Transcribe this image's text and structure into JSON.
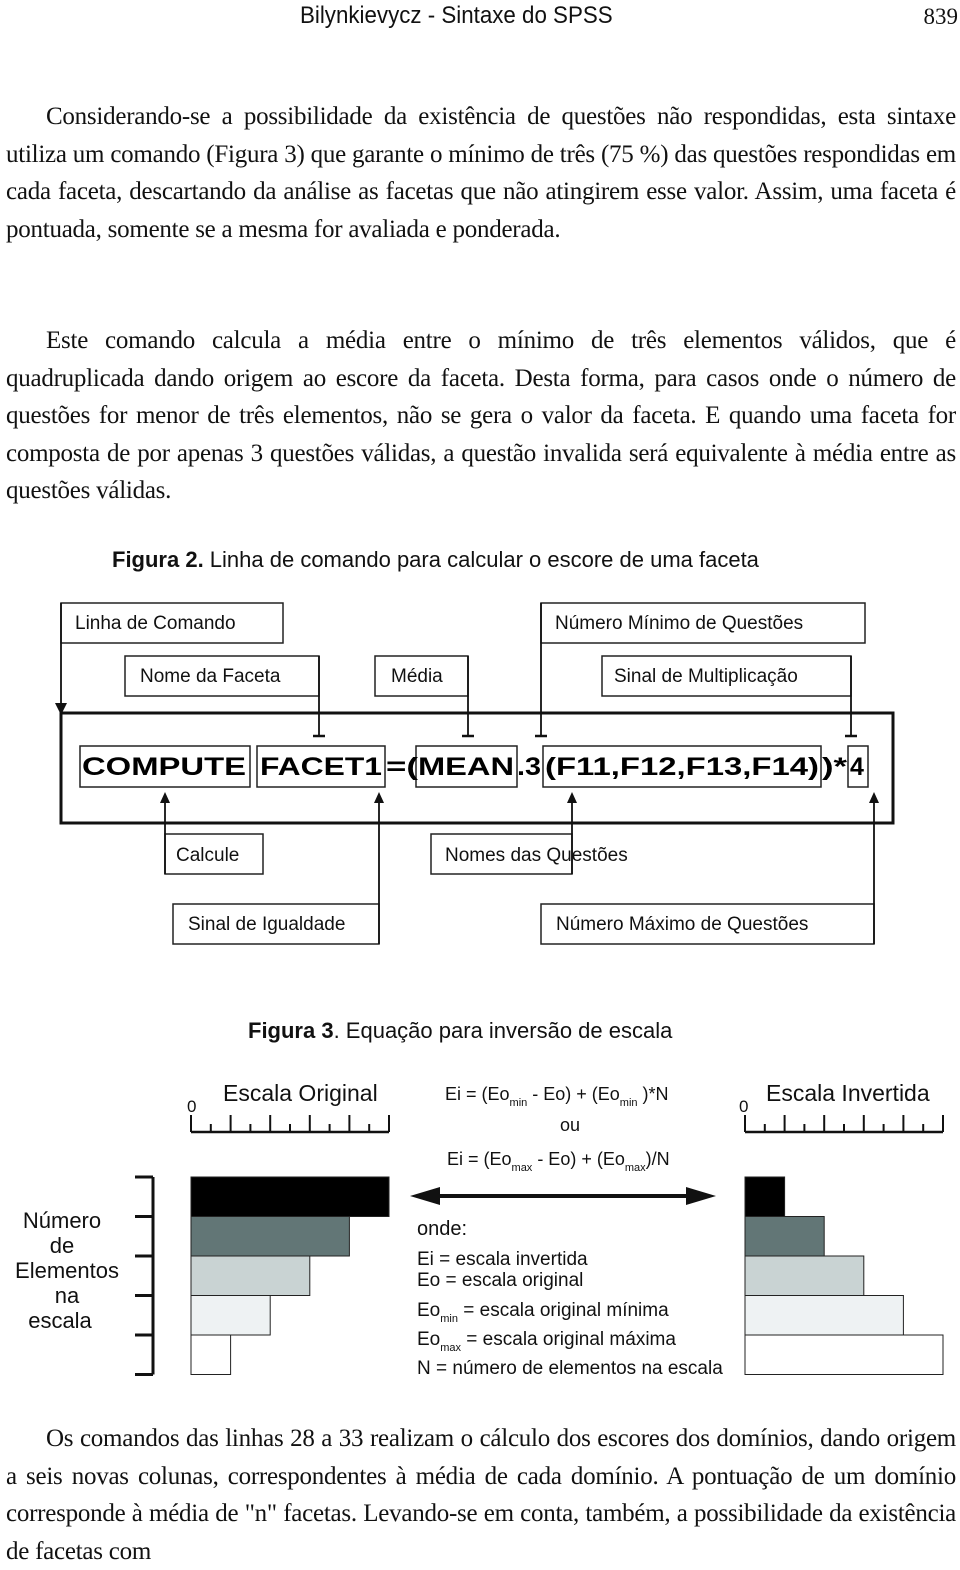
{
  "header": {
    "running_title": "Bilynkievycz - Sintaxe do SPSS",
    "page_number": "839"
  },
  "paragraphs": [
    "Considerando-se a possibilidade da existência de questões não respondidas, esta sintaxe utiliza um comando (Figura 3) que garante o mínimo de três (75 %) das questões respondidas em cada faceta, descartando da análise as facetas que não atingirem esse valor. Assim, uma faceta é pontuada, somente se a mesma for avaliada e ponderada.",
    "Este comando calcula a média entre o mínimo de três elementos válidos, que é quadruplicada dando origem ao escore da faceta. Desta forma, para casos onde o número de questões for menor de três elementos, não se gera o valor da faceta. E quando uma faceta for composta de por apenas 3 questões válidas, a questão invalida será equivalente à média entre as questões válidas.",
    "Os comandos das linhas 28 a 33 realizam o cálculo dos escores dos domínios, dando origem a seis novas colunas, correspondentes à média de cada domínio. A pontuação de um domínio corresponde à média de \"n\" facetas. Levando-se em conta, também, a possibilidade da existência de facetas com"
  ],
  "figure2": {
    "caption_label": "Figura 2.",
    "caption_text": " Linha de comando para calcular o escore de uma faceta",
    "top_labels": {
      "linha_de_comando": "Linha de Comando",
      "nome_da_faceta": "Nome da Faceta",
      "media": "Média",
      "numero_minimo": "Número Mínimo de Questões",
      "sinal_multiplicacao": "Sinal de Multiplicação"
    },
    "bottom_labels": {
      "calcule": "Calcule",
      "sinal_igualdade": "Sinal de Igualdade",
      "nomes_questoes": "Nomes das Questões",
      "numero_maximo": "Número Máximo de Questões"
    },
    "command_parts": {
      "compute": "COMPUTE",
      "facet": "FACET1",
      "equals_paren": "=(",
      "mean": "MEAN",
      "dot3": ".3",
      "args": "(F11,F12,F13,F14)",
      "close_mult": ")*",
      "four": "4"
    }
  },
  "figure3": {
    "caption_label": "Figura 3",
    "caption_text": ". Equação para inversão de escala",
    "left_scale": {
      "title": "Escala Original",
      "zero": "0"
    },
    "right_scale": {
      "title": "Escala Invertida",
      "zero": "0"
    },
    "y_label_lines": [
      "Número",
      "de",
      "Elementos",
      "na",
      "escala"
    ],
    "equation1": {
      "a": "Ei = (Eo",
      "sub1": "min",
      "b": " - Eo) + (Eo",
      "sub2": "min",
      "c": " )*N"
    },
    "or": "ou",
    "equation2": {
      "a": "Ei = (Eo",
      "sub1": "max",
      "b": " - Eo) + (Eo",
      "sub2": "max",
      "c": ")/N"
    },
    "legend_title": "onde:",
    "legend": [
      {
        "sym": "Ei",
        "sub": "",
        "text": "  = escala invertida"
      },
      {
        "sym": "Eo",
        "sub": "",
        "text": " = escala original"
      },
      {
        "sym": "Eo",
        "sub": "min",
        "text": " = escala original mínima"
      },
      {
        "sym": "Eo",
        "sub": "max",
        "text": " = escala original máxima"
      },
      {
        "sym": "N",
        "sub": "",
        "text": " = número de elementos na escala"
      }
    ],
    "original_bars": [
      {
        "level": 5,
        "color": "#000000"
      },
      {
        "level": 4,
        "color": "#627676"
      },
      {
        "level": 3,
        "color": "#c9d3d3"
      },
      {
        "level": 2,
        "color": "#eef2f3"
      },
      {
        "level": 1,
        "color": "#ffffff"
      }
    ],
    "inverted_bars": [
      {
        "level": 1,
        "color": "#000000"
      },
      {
        "level": 2,
        "color": "#627676"
      },
      {
        "level": 3,
        "color": "#c9d3d3"
      },
      {
        "level": 4,
        "color": "#eef2f3"
      },
      {
        "level": 5,
        "color": "#ffffff"
      }
    ],
    "scale_max": 5
  }
}
